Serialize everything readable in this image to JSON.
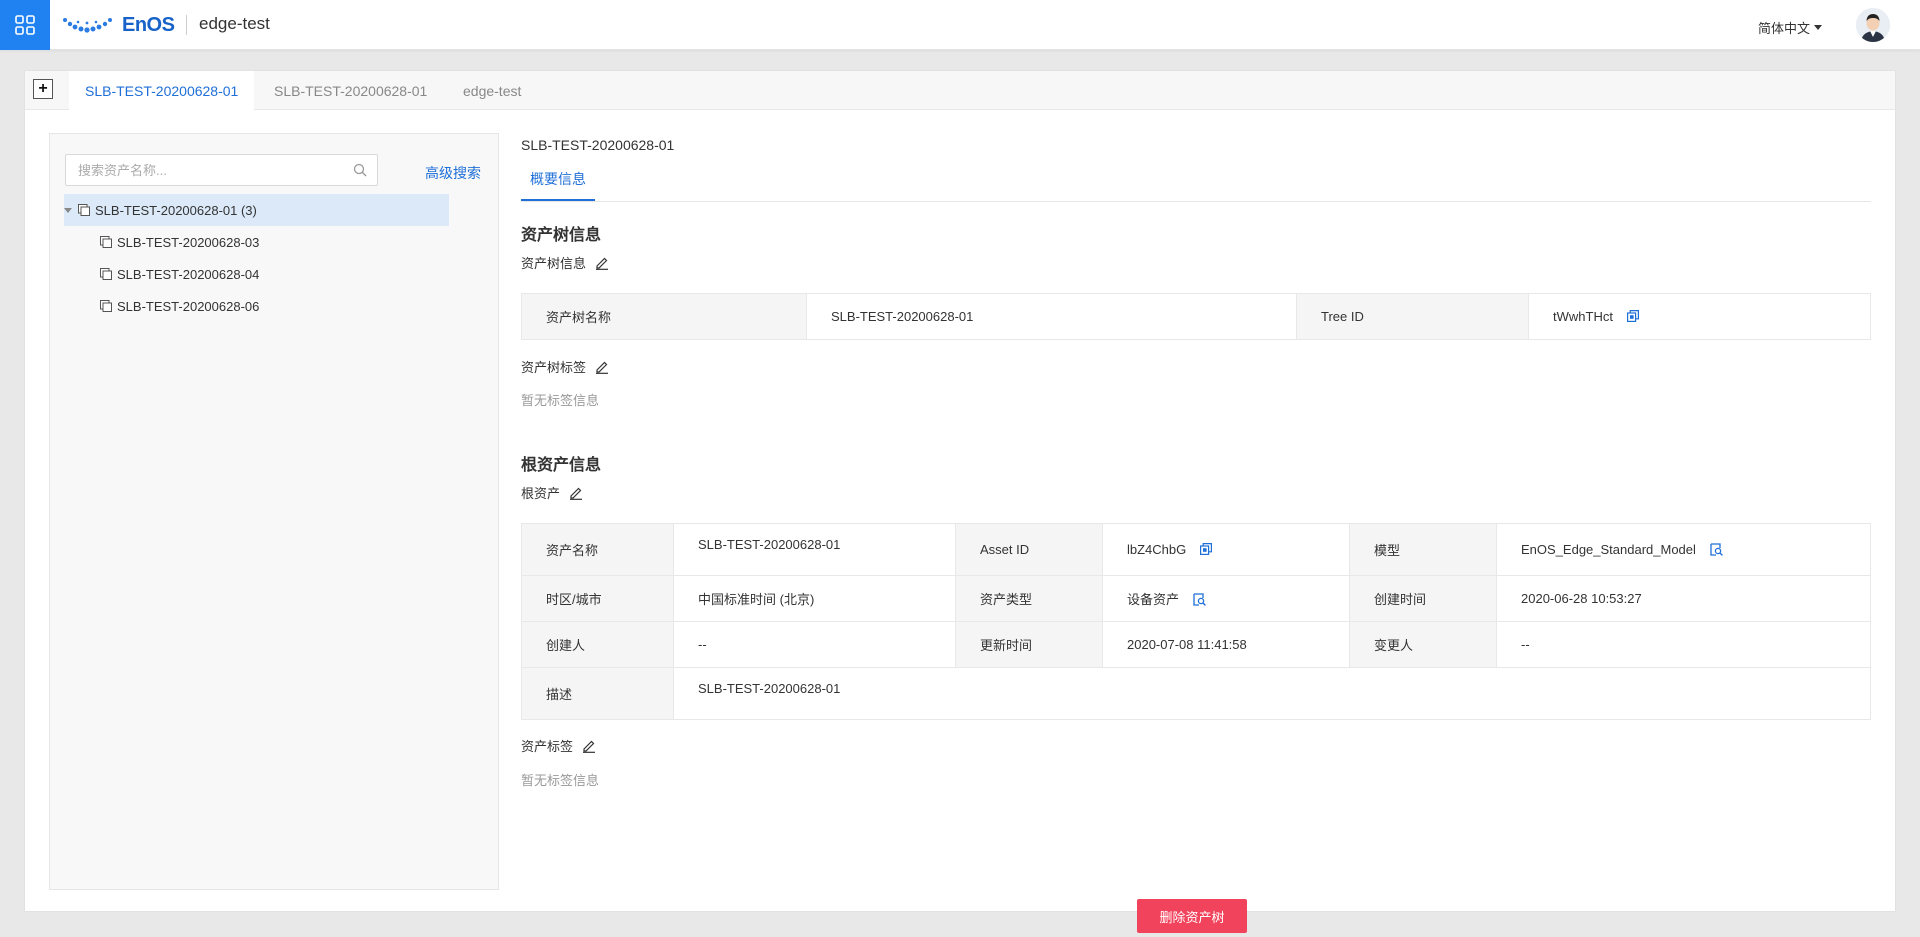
{
  "header": {
    "logo_text": "EnOS",
    "app_name": "edge-test",
    "language": "简体中文",
    "icons": {
      "apps": "grid-apps-icon",
      "avatar": "user-avatar"
    }
  },
  "tabs": [
    {
      "label": "SLB-TEST-20200628-01",
      "active": true
    },
    {
      "label": "SLB-TEST-20200628-01",
      "active": false
    },
    {
      "label": "edge-test",
      "active": false
    }
  ],
  "add_tab_label": "+",
  "sidebar": {
    "search_placeholder": "搜索资产名称...",
    "advanced_search": "高级搜索",
    "tree": {
      "root": "SLB-TEST-20200628-01 (3)",
      "children": [
        "SLB-TEST-20200628-03",
        "SLB-TEST-20200628-04",
        "SLB-TEST-20200628-06"
      ]
    }
  },
  "main": {
    "title": "SLB-TEST-20200628-01",
    "subtab": "概要信息",
    "tree_section": {
      "title": "资产树信息",
      "info_label": "资产树信息",
      "table": {
        "name_key": "资产树名称",
        "name_value": "SLB-TEST-20200628-01",
        "id_key": "Tree ID",
        "id_value": "tWwhTHct"
      },
      "tags_label": "资产树标签",
      "no_tags": "暂无标签信息"
    },
    "root_section": {
      "title": "根资产信息",
      "root_label": "根资产",
      "table": {
        "name_key": "资产名称",
        "name_value": "SLB-TEST-20200628-01",
        "asset_id_key": "Asset ID",
        "asset_id_value": "lbZ4ChbG",
        "model_key": "模型",
        "model_value": "EnOS_Edge_Standard_Model",
        "timezone_key": "时区/城市",
        "timezone_value": "中国标准时间 (北京)",
        "type_key": "资产类型",
        "type_value": "设备资产",
        "created_key": "创建时间",
        "created_value": "2020-06-28 10:53:27",
        "creator_key": "创建人",
        "creator_value": "--",
        "updated_key": "更新时间",
        "updated_value": "2020-07-08 11:41:58",
        "modifier_key": "变更人",
        "modifier_value": "--",
        "desc_key": "描述",
        "desc_value": "SLB-TEST-20200628-01"
      },
      "tags_label": "资产标签",
      "no_tags": "暂无标签信息"
    },
    "delete_button": "删除资产树"
  },
  "colors": {
    "accent": "#1f6fd8",
    "apps_bg": "#1f82f0",
    "danger": "#f2435c"
  }
}
